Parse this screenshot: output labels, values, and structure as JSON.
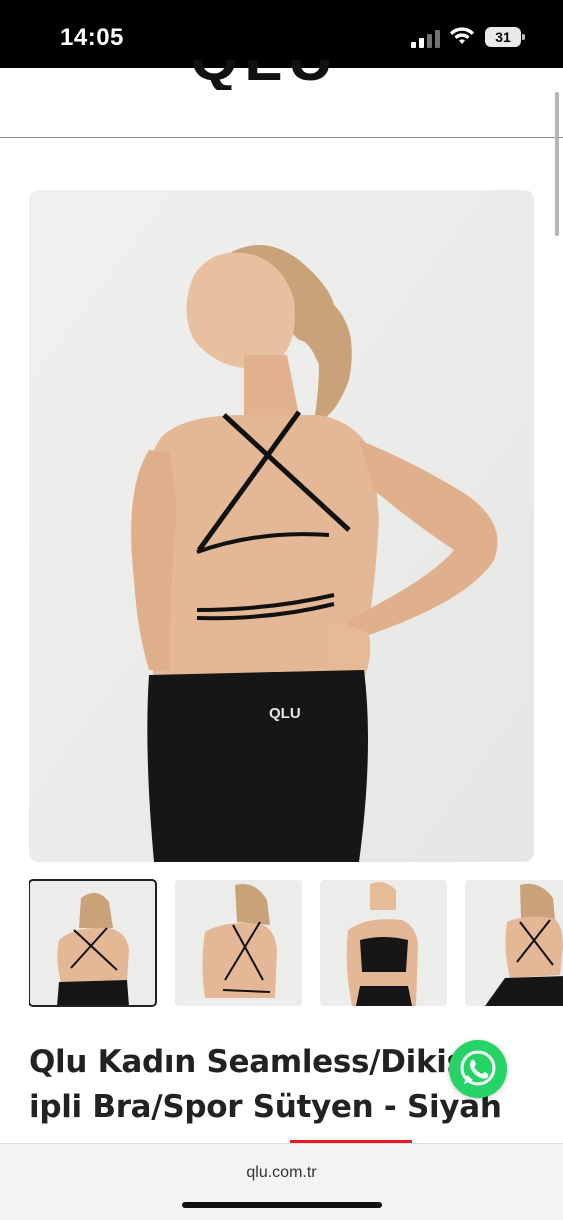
{
  "status_bar": {
    "time": "14:05",
    "battery": "31"
  },
  "header": {
    "logo": "QLU"
  },
  "product": {
    "main_image_alt": "product-photo-back-view",
    "thumbnails": [
      {
        "name": "thumb-1",
        "selected": true
      },
      {
        "name": "thumb-2",
        "selected": false
      },
      {
        "name": "thumb-3",
        "selected": false
      },
      {
        "name": "thumb-4",
        "selected": false
      }
    ],
    "title_line1": "Qlu Kadın Seamless/Dikiş",
    "title_line2": "ipli Bra/Spor Sütyen - Siyah",
    "waistband_logo": "QLU"
  },
  "floating": {
    "whatsapp_icon": "whatsapp-icon"
  },
  "browser": {
    "url": "qlu.com.tr"
  },
  "colors": {
    "accent": "#e31b23",
    "whatsapp": "#25d366",
    "bg": "#ececea"
  }
}
